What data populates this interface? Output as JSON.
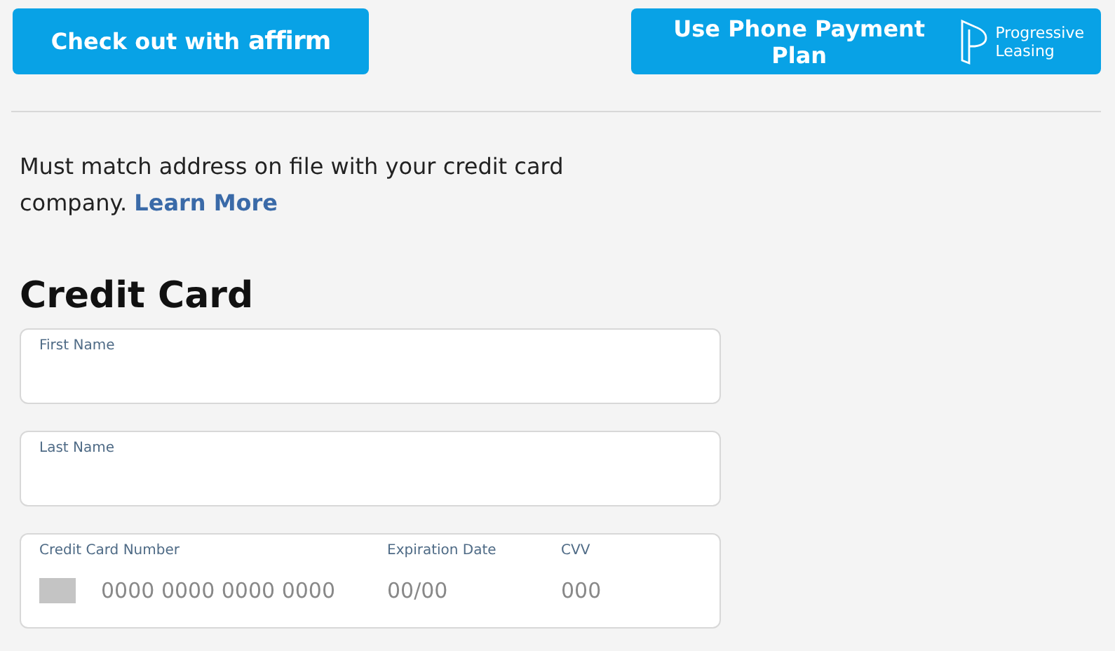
{
  "payment_buttons": [
    {
      "kind": "affirm",
      "label": "Check out with",
      "logo": "affirm"
    },
    {
      "kind": "progressive",
      "label": "Use Phone Payment Plan",
      "logo_lines": [
        "Progressive",
        "Leasing"
      ]
    }
  ],
  "notice": {
    "text": "Must match address on file with your credit card company.",
    "link": "Learn More"
  },
  "section_title": "Credit Card",
  "fields": [
    {
      "label": "First Name"
    },
    {
      "label": "Last Name"
    }
  ],
  "card_fields": [
    {
      "kind": "number",
      "label": "Credit Card Number",
      "placeholder": "0000 0000 0000 0000"
    },
    {
      "kind": "expiry",
      "label": "Expiration Date",
      "placeholder": "00/00"
    },
    {
      "kind": "cvv",
      "label": "CVV",
      "placeholder": "000"
    }
  ]
}
